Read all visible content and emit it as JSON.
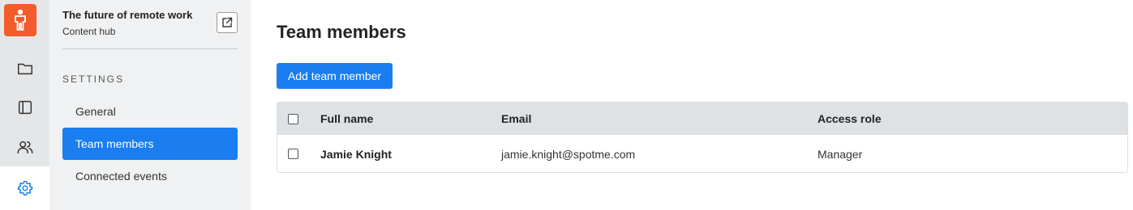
{
  "sidebar": {
    "project_title": "The future of remote work",
    "project_subtitle": "Content hub",
    "section_label": "SETTINGS",
    "items": [
      {
        "label": "General",
        "active": false
      },
      {
        "label": "Team members",
        "active": true
      },
      {
        "label": "Connected events",
        "active": false
      }
    ]
  },
  "rail": {
    "logo_icon": "person-logo-icon",
    "items": [
      {
        "icon": "folder-icon",
        "active": false
      },
      {
        "icon": "sidebar-panel-icon",
        "active": false
      },
      {
        "icon": "users-icon",
        "active": false
      },
      {
        "icon": "gear-icon",
        "active": true
      }
    ]
  },
  "main": {
    "title": "Team members",
    "add_button_label": "Add team member",
    "table": {
      "headers": [
        "Full name",
        "Email",
        "Access role"
      ],
      "rows": [
        {
          "name": "Jamie Knight",
          "email": "jamie.knight@spotme.com",
          "role": "Manager"
        }
      ]
    }
  },
  "colors": {
    "accent": "#1a7df0",
    "brand": "#f25c2b"
  }
}
